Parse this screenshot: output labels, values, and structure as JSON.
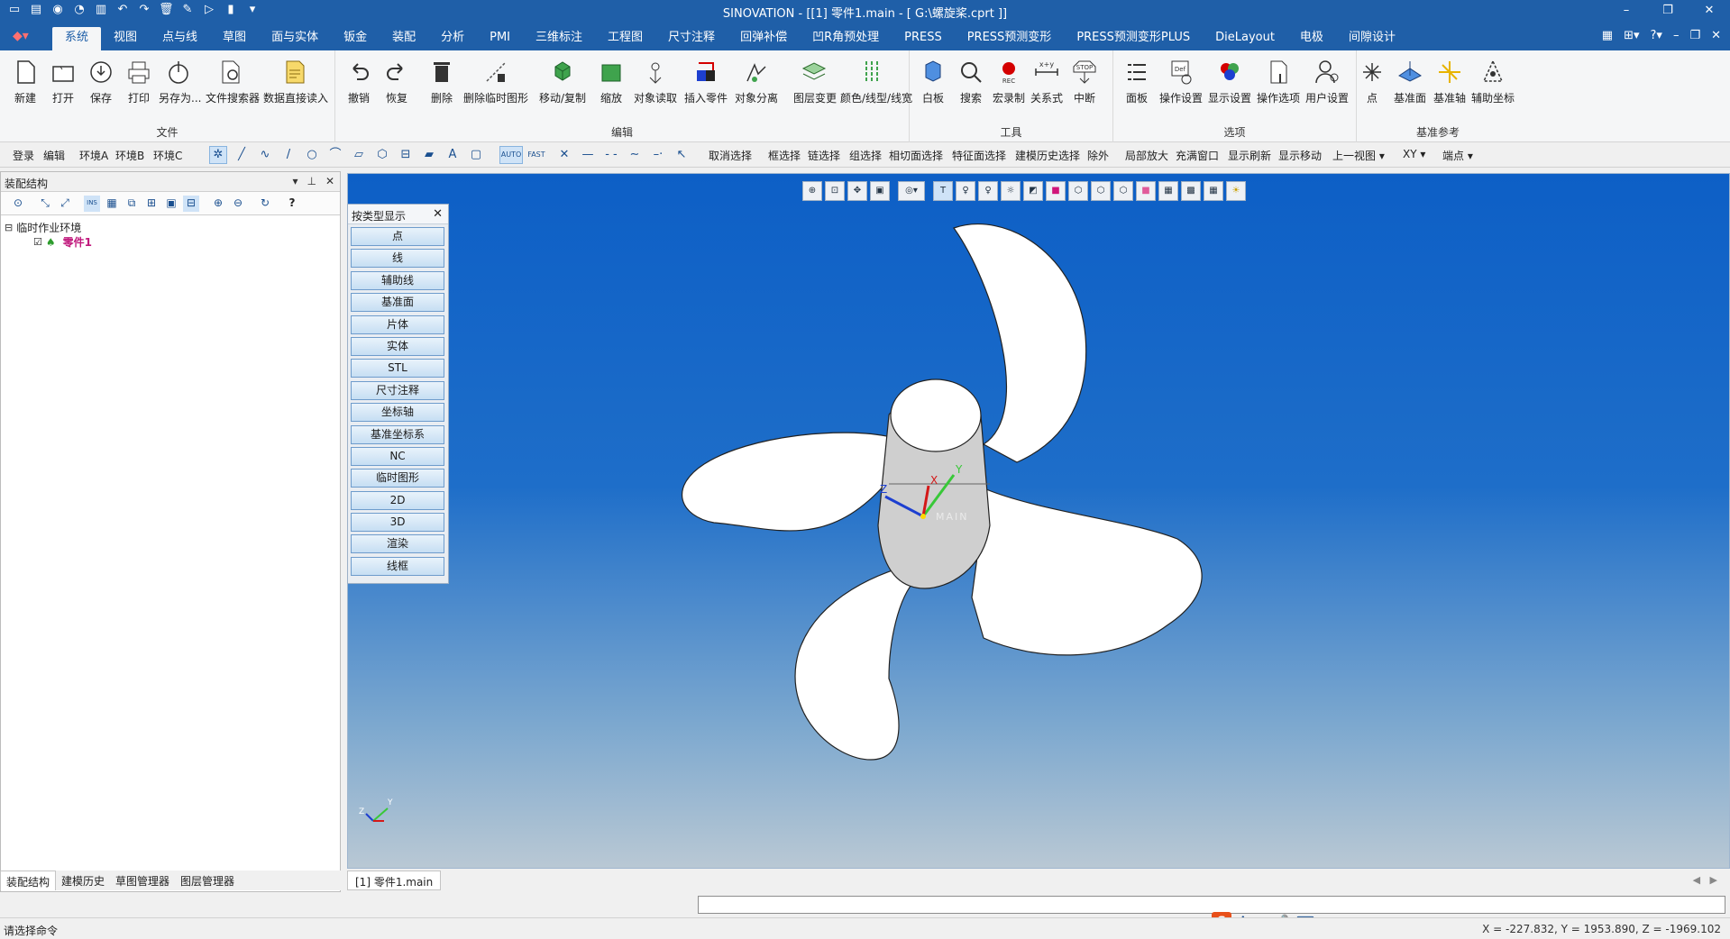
{
  "window": {
    "title": "SINOVATION - [[1] 零件1.main - [ G:\\螺旋桨.cprt ]]"
  },
  "menu": {
    "tabs": [
      "系统",
      "视图",
      "点与线",
      "草图",
      "面与实体",
      "钣金",
      "装配",
      "分析",
      "PMI",
      "三维标注",
      "工程图",
      "尺寸注释",
      "回弹补偿",
      "凹R角预处理",
      "PRESS",
      "PRESS预测变形",
      "PRESS预测变形PLUS",
      "DieLayout",
      "电极",
      "间隙设计"
    ],
    "active_tab": "系统"
  },
  "ribbon": {
    "groups": {
      "file": {
        "name": "文件",
        "buttons": [
          "新建",
          "打开",
          "保存",
          "打印",
          "另存为...",
          "文件搜索器",
          "数据直接读入"
        ]
      },
      "edit": {
        "name": "编辑",
        "buttons": [
          "撤销",
          "恢复",
          "删除",
          "删除临时图形",
          "移动/复制",
          "缩放",
          "对象读取",
          "插入零件",
          "对象分离",
          "图层变更",
          "颜色/线型/线宽"
        ]
      },
      "tools": {
        "name": "工具",
        "buttons": [
          "白板",
          "搜索",
          "宏录制",
          "关系式",
          "中断"
        ]
      },
      "options": {
        "name": "选项",
        "buttons": [
          "面板",
          "操作设置",
          "显示设置",
          "操作选项",
          "用户设置"
        ]
      },
      "datum": {
        "name": "基准参考",
        "buttons": [
          "点",
          "基准面",
          "基准轴",
          "辅助坐标"
        ]
      }
    }
  },
  "toolbar2": {
    "left_items": [
      "登录",
      "编辑",
      "环境A",
      "环境B",
      "环境C"
    ],
    "modes": [
      "AUTO",
      "FAST"
    ],
    "right_items": [
      "取消选择",
      "框选择",
      "链选择",
      "组选择",
      "相切面选择",
      "特征面选择",
      "建模历史选择",
      "除外",
      "局部放大",
      "充满窗口",
      "显示刷新",
      "显示移动",
      "上一视图",
      "XY",
      "端点"
    ]
  },
  "left_panel": {
    "title": "装配结构",
    "tree": {
      "root": "临时作业环境",
      "child": "零件1"
    },
    "bottom_tabs": [
      "装配结构",
      "建模历史",
      "草图管理器",
      "图层管理器"
    ],
    "active_bottom_tab": "装配结构"
  },
  "type_panel": {
    "title": "按类型显示",
    "buttons": [
      "点",
      "线",
      "辅助线",
      "基准面",
      "片体",
      "实体",
      "STL",
      "尺寸注释",
      "坐标轴",
      "基准坐标系",
      "NC",
      "临时图形",
      "2D",
      "3D",
      "渲染",
      "线框"
    ]
  },
  "viewport": {
    "doc_tab": "[1] 零件1.main",
    "axis_labels": {
      "x": "X",
      "y": "Y",
      "z": "Z"
    },
    "main_label": "MAIN"
  },
  "status": {
    "prompt": "请选择命令",
    "coords": "X = -227.832, Y = 1953.890, Z = -1969.102"
  },
  "colors": {
    "title_blue": "#1f5fa8",
    "viewport_top": "#0d5fc6",
    "tree_part": "#c0187c"
  }
}
